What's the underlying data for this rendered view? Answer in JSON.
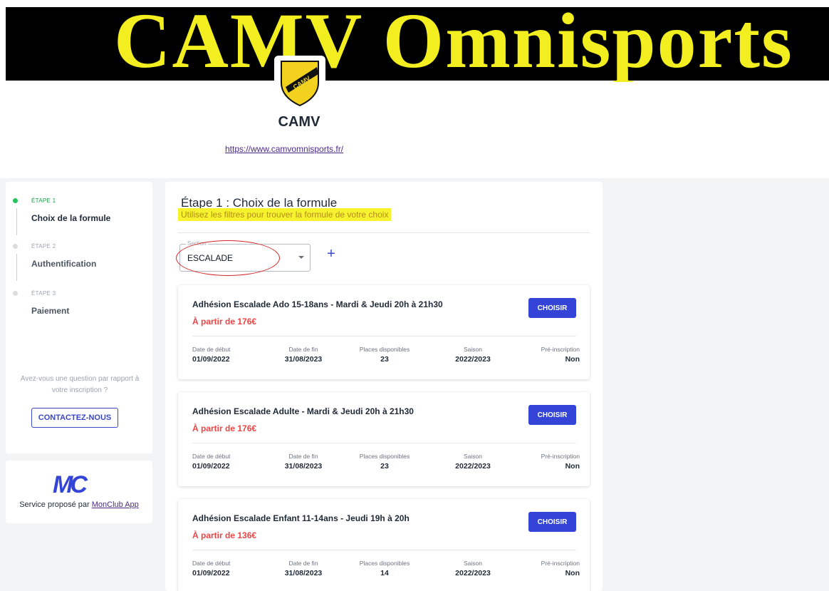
{
  "banner": {
    "text": "CAMV Omnisports"
  },
  "club": {
    "logo_text": "CAMV",
    "name": "CAMV",
    "website": "https://www.camvomnisports.fr/"
  },
  "stepper": {
    "steps": [
      {
        "label": "ÉTAPE 1",
        "title": "Choix de la formule",
        "state": "active"
      },
      {
        "label": "ÉTAPE 2",
        "title": "Authentification",
        "state": "pending"
      },
      {
        "label": "ÉTAPE 3",
        "title": "Paiement",
        "state": "pending"
      }
    ],
    "question": "Avez-vous une question par rapport à votre inscription ?",
    "contact_label": "CONTACTEZ-NOUS"
  },
  "service": {
    "logo_text": "MC",
    "prefix": "Service proposé par",
    "link_text": "MonClub App"
  },
  "main": {
    "title": "Étape 1 : Choix de la formule",
    "subtitle": "Utilisez les filtres pour trouver la formule de votre choix",
    "filter": {
      "label": "Section",
      "value": "ESCALADE",
      "add_icon": "plus-icon"
    },
    "choose_label": "CHOISIR",
    "meta_labels": {
      "start": "Date de début",
      "end": "Date de fin",
      "places": "Places disponibles",
      "season": "Saison",
      "prereg": "Pré-inscription"
    },
    "offers": [
      {
        "title": "Adhésion Escalade Ado 15-18ans - Mardi & Jeudi 20h à 21h30",
        "price": "À partir de 176€",
        "start": "01/09/2022",
        "end": "31/08/2023",
        "places": "23",
        "season": "2022/2023",
        "prereg": "Non"
      },
      {
        "title": "Adhésion Escalade Adulte - Mardi & Jeudi 20h à 21h30",
        "price": "À partir de 176€",
        "start": "01/09/2022",
        "end": "31/08/2023",
        "places": "23",
        "season": "2022/2023",
        "prereg": "Non"
      },
      {
        "title": "Adhésion Escalade Enfant 11-14ans - Jeudi 19h à 20h",
        "price": "À partir de 136€",
        "start": "01/09/2022",
        "end": "31/08/2023",
        "places": "14",
        "season": "2022/2023",
        "prereg": "Non"
      }
    ]
  },
  "colors": {
    "accent": "#3344d6",
    "active_step": "#22c55e",
    "price": "#ef4444",
    "highlight": "#f6f22e",
    "banner_text": "#f2ee1f"
  }
}
